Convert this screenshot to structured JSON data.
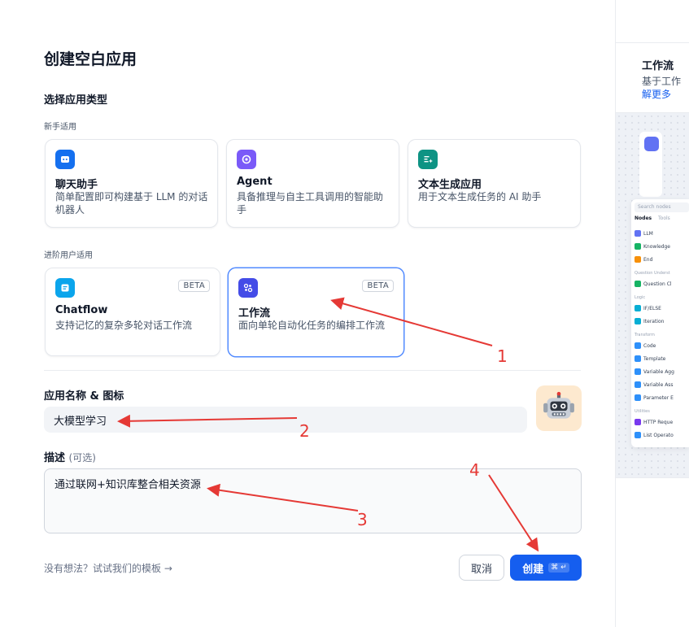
{
  "dialog": {
    "title": "创建空白应用",
    "type_section": "选择应用类型",
    "beginner_label": "新手适用",
    "advanced_label": "进阶用户适用",
    "beginner_cards": [
      {
        "title": "聊天助手",
        "desc": "简单配置即可构建基于 LLM 的对话机器人",
        "icon": "chat-bot-icon",
        "color": "#1570ef"
      },
      {
        "title": "Agent",
        "desc": "具备推理与自主工具调用的智能助手",
        "icon": "agent-icon",
        "color": "#7a5af8"
      },
      {
        "title": "文本生成应用",
        "desc": "用于文本生成任务的 AI 助手",
        "icon": "text-generation-icon",
        "color": "#0e9384"
      }
    ],
    "advanced_cards": [
      {
        "title": "Chatflow",
        "desc": "支持记忆的复杂多轮对话工作流",
        "icon": "chatflow-icon",
        "color": "#0ba5ec",
        "badge": "BETA"
      },
      {
        "title": "工作流",
        "desc": "面向单轮自动化任务的编排工作流",
        "icon": "workflow-icon",
        "color": "#444ce7",
        "badge": "BETA"
      }
    ],
    "name_label": "应用名称 & 图标",
    "name_value": "大模型学习",
    "avatar_icon": "robot-icon",
    "desc_label": "描述",
    "desc_optional": "(可选)",
    "desc_value": "通过联网+知识库整合相关资源",
    "template_link": "没有想法？试试我们的模板 →",
    "cancel_label": "取消",
    "create_label": "创建",
    "create_shortcut": "⌘ ↵"
  },
  "preview": {
    "title": "工作流",
    "desc": "基于工作",
    "more": "解更多",
    "search_placeholder": "Search nodes",
    "tabs": [
      "Nodes",
      "Tools"
    ],
    "items": [
      {
        "type": "item",
        "label": "LLM",
        "color": "#6172f3"
      },
      {
        "type": "item",
        "label": "Knowledge",
        "color": "#16b364"
      },
      {
        "type": "item",
        "label": "End",
        "color": "#f79009"
      },
      {
        "type": "group",
        "label": "Question Underst"
      },
      {
        "type": "item",
        "label": "Question Cl",
        "color": "#16b364"
      },
      {
        "type": "group",
        "label": "Logic"
      },
      {
        "type": "item",
        "label": "IF/ELSE",
        "color": "#06aed4"
      },
      {
        "type": "item",
        "label": "Iteration",
        "color": "#06aed4"
      },
      {
        "type": "group",
        "label": "Transform"
      },
      {
        "type": "item",
        "label": "Code",
        "color": "#2e90fa"
      },
      {
        "type": "item",
        "label": "Template",
        "color": "#2e90fa"
      },
      {
        "type": "item",
        "label": "Variable Agg",
        "color": "#2e90fa"
      },
      {
        "type": "item",
        "label": "Variable Ass",
        "color": "#2e90fa"
      },
      {
        "type": "item",
        "label": "Parameter E",
        "color": "#2e90fa"
      },
      {
        "type": "group",
        "label": "Utilities"
      },
      {
        "type": "item",
        "label": "HTTP Reque",
        "color": "#7839ee"
      },
      {
        "type": "item",
        "label": "List Operato",
        "color": "#2e90fa"
      }
    ]
  },
  "annotations": [
    "1",
    "2",
    "3",
    "4"
  ]
}
